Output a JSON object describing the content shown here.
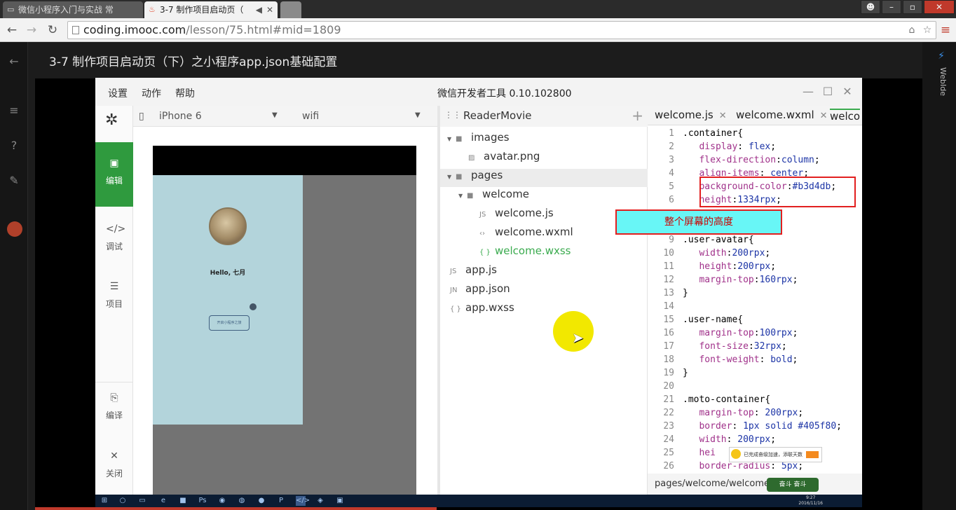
{
  "browser": {
    "tabs": [
      {
        "label": "微信小程序入门与实战 常"
      },
      {
        "label": "3-7 制作项目启动页（"
      }
    ],
    "url": {
      "host": "coding.imooc.com",
      "path": "/lesson/75.html#mid=1809"
    }
  },
  "page": {
    "lesson_title": "3-7 制作项目启动页（下）之小程序app.json基础配置",
    "right_rail_label": "WebIde"
  },
  "devtool": {
    "menu": [
      "设置",
      "动作",
      "帮助"
    ],
    "title": "微信开发者工具 0.10.102800",
    "sidebar": [
      {
        "label": "编辑",
        "icon": "code-icon",
        "active": true
      },
      {
        "label": "调试",
        "icon": "debug-icon",
        "active": false
      },
      {
        "label": "项目",
        "icon": "menu-icon",
        "active": false
      },
      {
        "label": "编译",
        "icon": "compile-icon",
        "active": false
      },
      {
        "label": "关闭",
        "icon": "close-icon",
        "active": false
      }
    ],
    "simulator": {
      "device": "iPhone 6",
      "network": "wifi",
      "hello_text": "Hello, 七月",
      "button_text": "开启小程序之旅"
    },
    "tree": {
      "project": "ReaderMovie",
      "nodes": [
        {
          "label": "images"
        },
        {
          "label": "avatar.png"
        },
        {
          "label": "pages"
        },
        {
          "label": "welcome"
        },
        {
          "label": "welcome.js"
        },
        {
          "label": "welcome.wxml"
        },
        {
          "label": "welcome.wxss"
        },
        {
          "label": "app.js"
        },
        {
          "label": "app.json"
        },
        {
          "label": "app.wxss"
        }
      ]
    },
    "editor": {
      "tabs": [
        "welcome.js",
        "welcome.wxml",
        "welco"
      ],
      "status_path": "pages/welcome/welcome.wxss"
    }
  },
  "annotation": {
    "note": "整个屏幕的高度"
  },
  "overlay": {
    "popup_text": "已完成奋级加速，添联天数",
    "badge_text": "奋斗 奋斗",
    "clock": [
      "9:27",
      "2016/11/16"
    ]
  }
}
